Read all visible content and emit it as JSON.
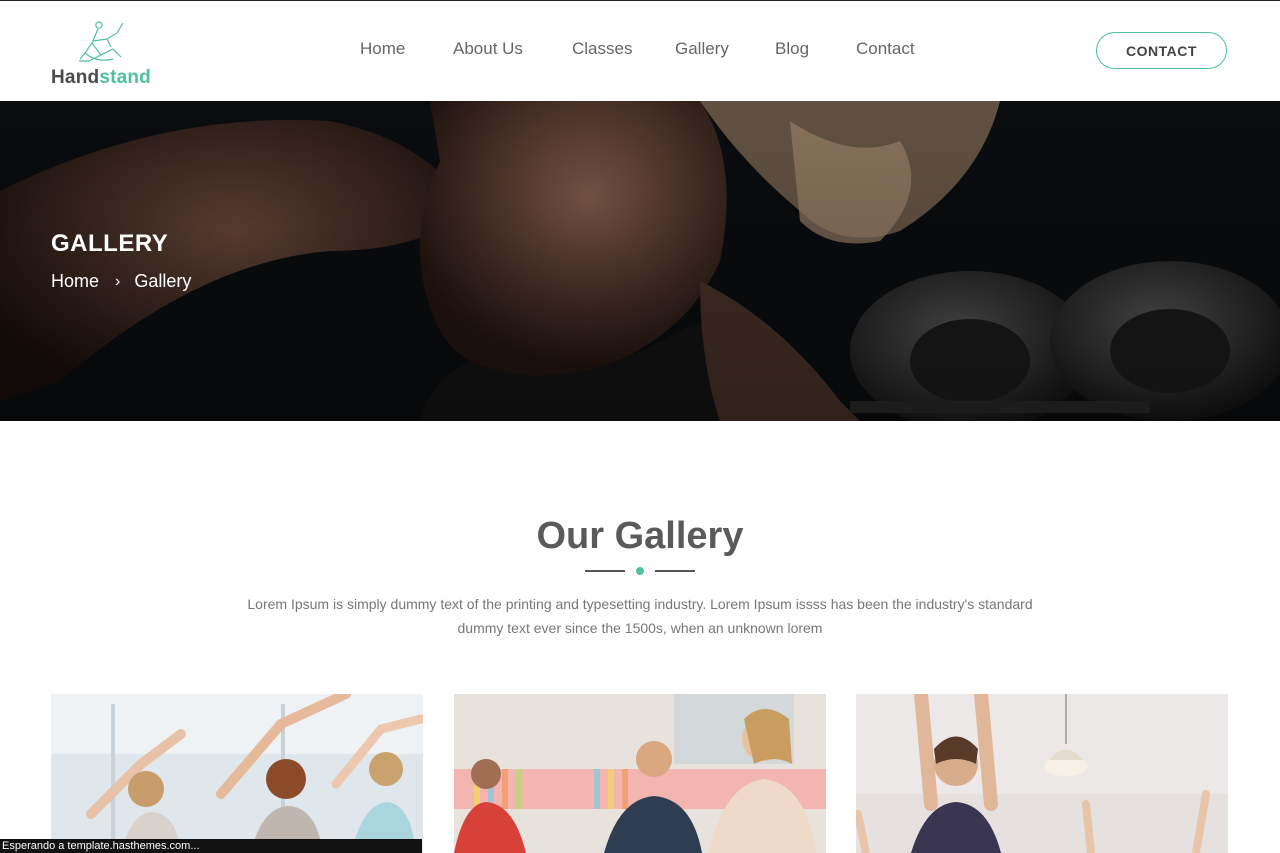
{
  "brand": {
    "name_part1": "Hand",
    "name_part2": "stand",
    "accent_color": "#4fc1a0"
  },
  "nav": {
    "items": [
      {
        "label": "Home"
      },
      {
        "label": "About Us"
      },
      {
        "label": "Classes"
      },
      {
        "label": "Gallery"
      },
      {
        "label": "Blog"
      },
      {
        "label": "Contact"
      }
    ],
    "cta_label": "CONTACT"
  },
  "hero": {
    "title": "GALLERY",
    "breadcrumb": {
      "home": "Home",
      "separator": "›",
      "current": "Gallery"
    }
  },
  "section": {
    "title": "Our Gallery",
    "description": "Lorem Ipsum is simply dummy text of the printing and typesetting industry. Lorem Ipsum issss has been the industry's standard dummy text ever since the 1500s, when an unknown lorem"
  },
  "gallery": [
    {
      "icon": "yoga-side-stretch-photo"
    },
    {
      "icon": "meditation-class-photo"
    },
    {
      "icon": "arms-raised-class-photo"
    }
  ],
  "status_bar": {
    "text": "Esperando a template.hasthemes.com..."
  }
}
